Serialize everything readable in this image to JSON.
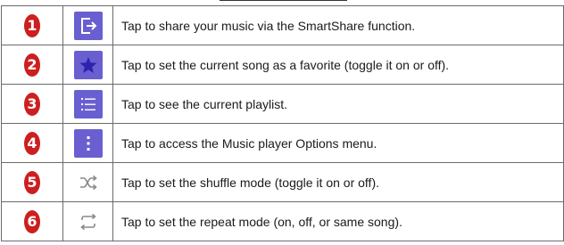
{
  "rows": [
    {
      "number": "1",
      "icon": "share-icon",
      "description": "Tap to share your music via the SmartShare function."
    },
    {
      "number": "2",
      "icon": "star-icon",
      "description": "Tap to set the current song as a favorite (toggle it on or off)."
    },
    {
      "number": "3",
      "icon": "playlist-icon",
      "description": "Tap to see the current playlist."
    },
    {
      "number": "4",
      "icon": "menu-dots-icon",
      "description": "Tap to access the Music player Options menu."
    },
    {
      "number": "5",
      "icon": "shuffle-icon",
      "description": "Tap to set the shuffle mode (toggle it on or off)."
    },
    {
      "number": "6",
      "icon": "repeat-icon",
      "description": "Tap to set the repeat mode (on, off, or same song)."
    }
  ],
  "colors": {
    "badge": "#cc1f1f",
    "icon_bg": "#6a5fd0",
    "icon_plain": "#8a8a8a",
    "border": "#6b6b6b"
  }
}
